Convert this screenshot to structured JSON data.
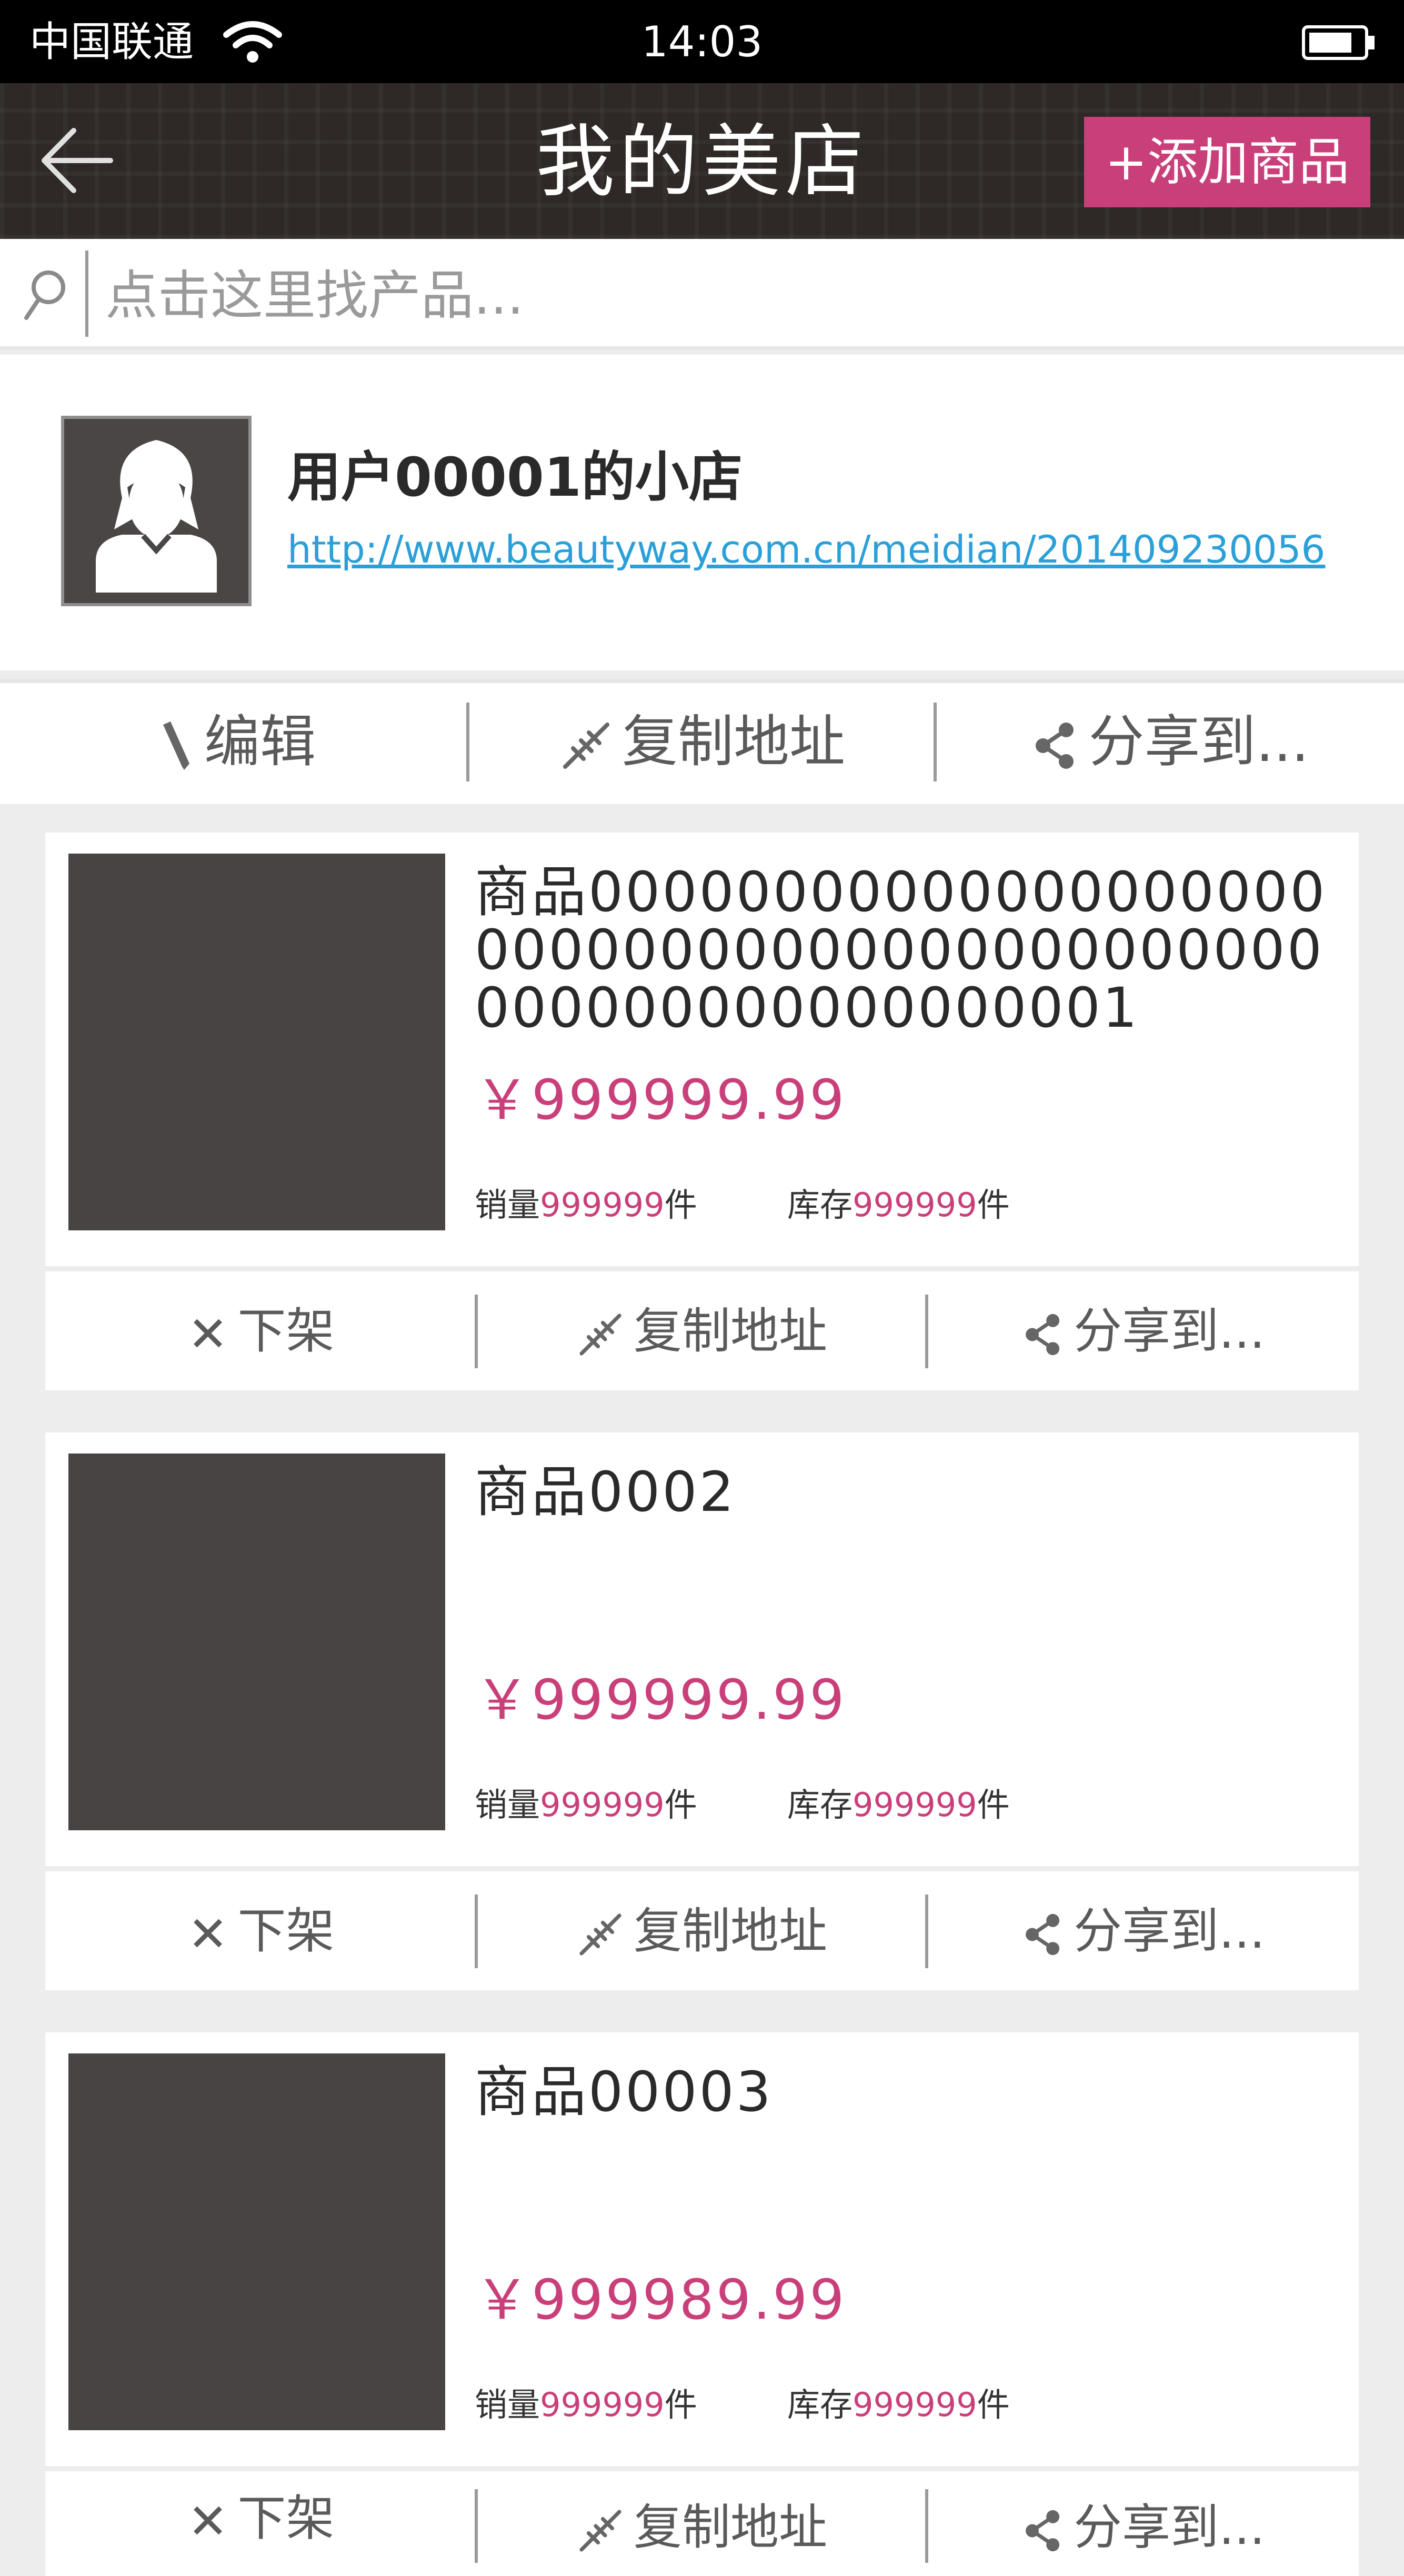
{
  "status": {
    "carrier": "中国联通",
    "time": "14:03"
  },
  "header": {
    "title": "我的美店",
    "add_button": "+添加商品"
  },
  "search": {
    "placeholder": "点击这里找产品..."
  },
  "shop": {
    "name": "用户00001的小店",
    "url": "http://www.beautyway.com.cn/meidian/201409230056",
    "actions": {
      "edit": "编辑",
      "copy": "复制地址",
      "share": "分享到..."
    }
  },
  "products": [
    {
      "name": "商品0000000000000000000000000000000000000000000000000000000000001",
      "price": "￥999999.99",
      "sales_label": "销量",
      "sales": "999999",
      "unit": "件",
      "stock_label": "库存",
      "stock": "999999"
    },
    {
      "name": "商品0002",
      "price": "￥999999.99",
      "sales_label": "销量",
      "sales": "999999",
      "unit": "件",
      "stock_label": "库存",
      "stock": "999999"
    },
    {
      "name": "商品00003",
      "price": "￥999989.99",
      "sales_label": "销量",
      "sales": "999999",
      "unit": "件",
      "stock_label": "库存",
      "stock": "999999"
    }
  ],
  "product_actions": {
    "remove": "下架",
    "copy": "复制地址",
    "share": "分享到..."
  },
  "colors": {
    "accent": "#c93f7a",
    "link": "#2ba0d8",
    "header_bg": "#2e2926",
    "thumb": "#484443"
  }
}
